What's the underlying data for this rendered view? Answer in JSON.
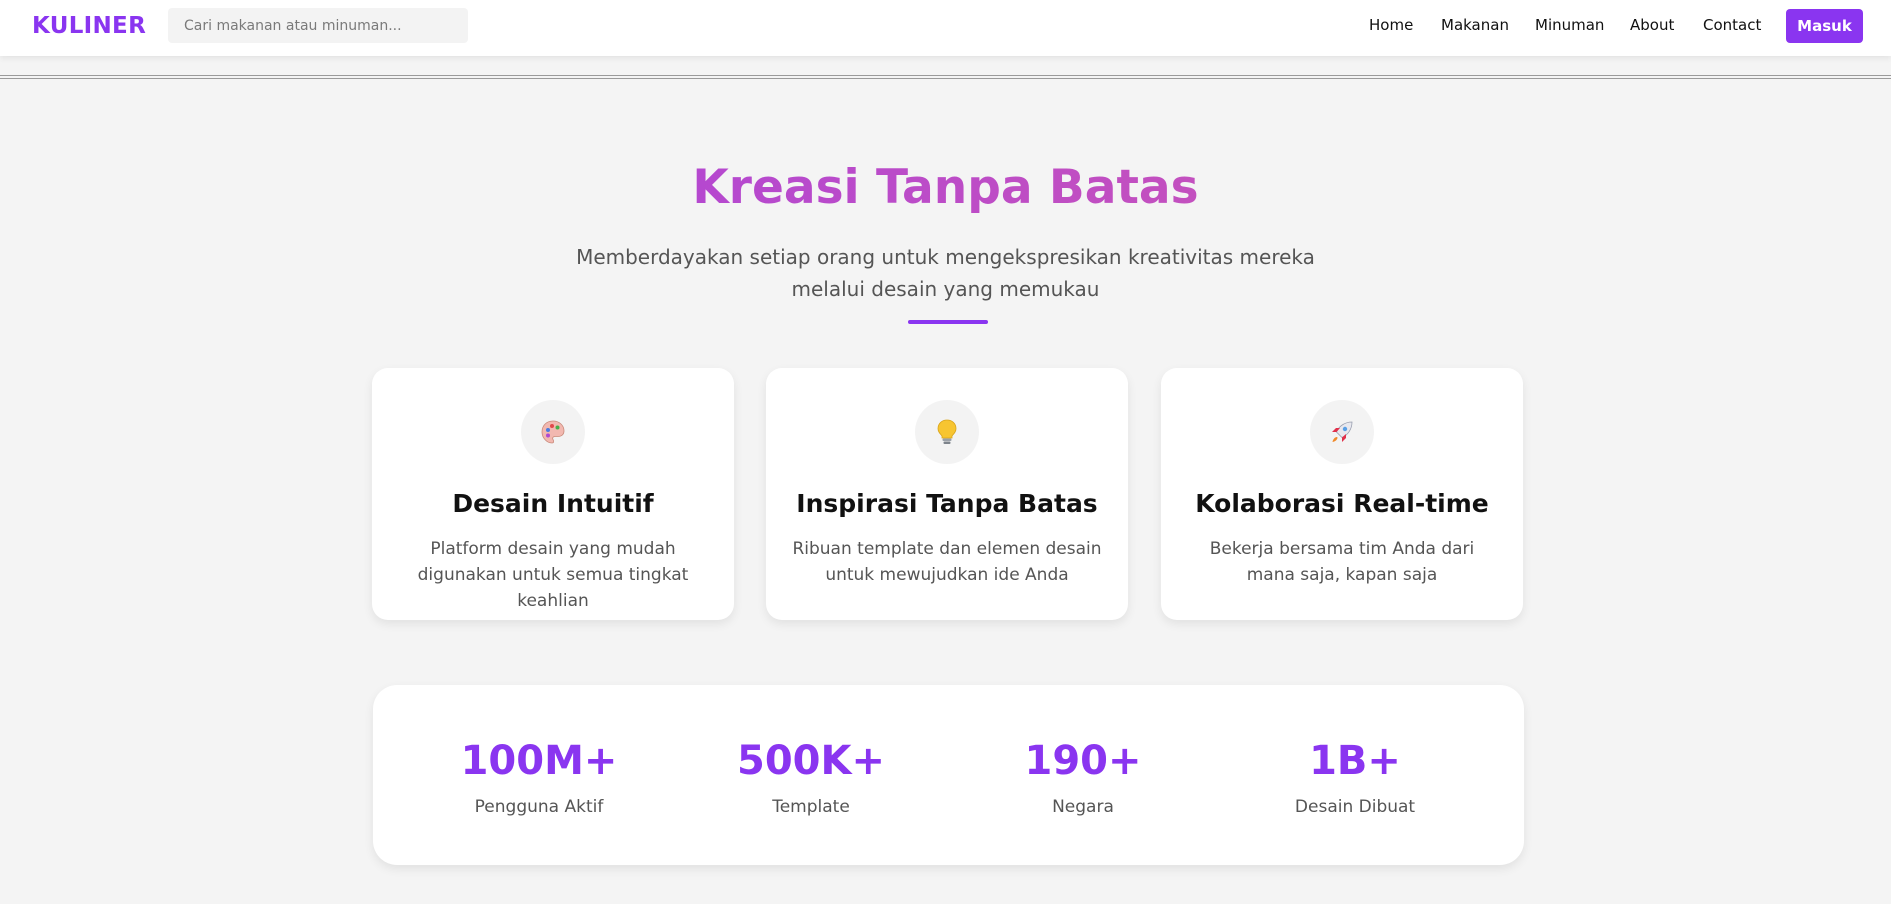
{
  "brand": {
    "name": "KULINER",
    "color": "#8a35f0"
  },
  "search": {
    "placeholder": "Cari makanan atau minuman..."
  },
  "nav": {
    "links": [
      "Home",
      "Makanan",
      "Minuman",
      "About",
      "Contact"
    ],
    "login_label": "Masuk"
  },
  "hero": {
    "title": "Kreasi Tanpa Batas",
    "subtitle": "Memberdayakan setiap orang untuk mengekspresikan kreativitas mereka melalui desain yang memukau"
  },
  "features": [
    {
      "icon": "palette-icon",
      "title": "Desain Intuitif",
      "description": "Platform desain yang mudah digunakan untuk semua tingkat keahlian"
    },
    {
      "icon": "lightbulb-icon",
      "title": "Inspirasi Tanpa Batas",
      "description": "Ribuan template dan elemen desain untuk mewujudkan ide Anda"
    },
    {
      "icon": "rocket-icon",
      "title": "Kolaborasi Real-time",
      "description": "Bekerja bersama tim Anda dari mana saja, kapan saja"
    }
  ],
  "stats": [
    {
      "value": "100M+",
      "label": "Pengguna Aktif"
    },
    {
      "value": "500K+",
      "label": "Template"
    },
    {
      "value": "190+",
      "label": "Negara"
    },
    {
      "value": "1B+",
      "label": "Desain Dibuat"
    }
  ],
  "colors": {
    "accent": "#8a35f0",
    "title_gradient_start": "#a23ee6",
    "title_gradient_end": "#d65aa8"
  }
}
